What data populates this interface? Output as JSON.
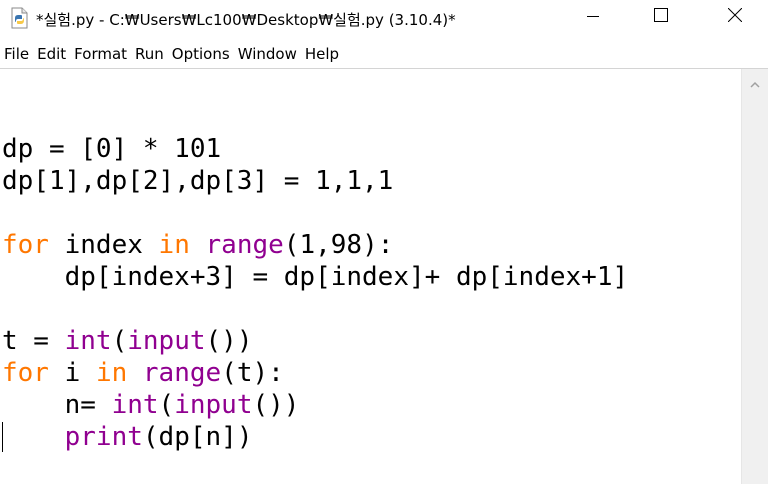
{
  "window": {
    "title": "*실험.py - C:₩Users₩Lc100₩Desktop₩실험.py (3.10.4)*"
  },
  "menu": {
    "items": [
      "File",
      "Edit",
      "Format",
      "Run",
      "Options",
      "Window",
      "Help"
    ]
  },
  "editor": {
    "lines": [
      [],
      [
        {
          "t": "dp = [0] * 101",
          "c": "plain"
        }
      ],
      [
        {
          "t": "dp[1],dp[2],dp[3] = 1,1,1",
          "c": "plain"
        }
      ],
      [],
      [
        {
          "t": "for",
          "c": "kw"
        },
        {
          "t": " index ",
          "c": "plain"
        },
        {
          "t": "in",
          "c": "kw"
        },
        {
          "t": " ",
          "c": "plain"
        },
        {
          "t": "range",
          "c": "bi"
        },
        {
          "t": "(1,98):",
          "c": "plain"
        }
      ],
      [
        {
          "t": "    dp[index+3] = dp[index]+ dp[index+1]",
          "c": "plain"
        }
      ],
      [],
      [
        {
          "t": "t = ",
          "c": "plain"
        },
        {
          "t": "int",
          "c": "bi"
        },
        {
          "t": "(",
          "c": "plain"
        },
        {
          "t": "input",
          "c": "bi"
        },
        {
          "t": "())",
          "c": "plain"
        }
      ],
      [
        {
          "t": "for",
          "c": "kw"
        },
        {
          "t": " i ",
          "c": "plain"
        },
        {
          "t": "in",
          "c": "kw"
        },
        {
          "t": " ",
          "c": "plain"
        },
        {
          "t": "range",
          "c": "bi"
        },
        {
          "t": "(t):",
          "c": "plain"
        }
      ],
      [
        {
          "t": "    n= ",
          "c": "plain"
        },
        {
          "t": "int",
          "c": "bi"
        },
        {
          "t": "(",
          "c": "plain"
        },
        {
          "t": "input",
          "c": "bi"
        },
        {
          "t": "())",
          "c": "plain"
        }
      ],
      [
        {
          "t": "    ",
          "c": "plain"
        },
        {
          "t": "print",
          "c": "bi"
        },
        {
          "t": "(dp[n])",
          "c": "plain"
        }
      ]
    ]
  },
  "colors": {
    "keyword": "#ff7700",
    "builtin": "#900090",
    "text": "#000000",
    "background": "#ffffff"
  },
  "icons": {
    "app": "python-file-icon",
    "minimize": "minimize-icon",
    "maximize": "maximize-icon",
    "close": "close-icon",
    "scroll_up": "chevron-up-icon"
  }
}
